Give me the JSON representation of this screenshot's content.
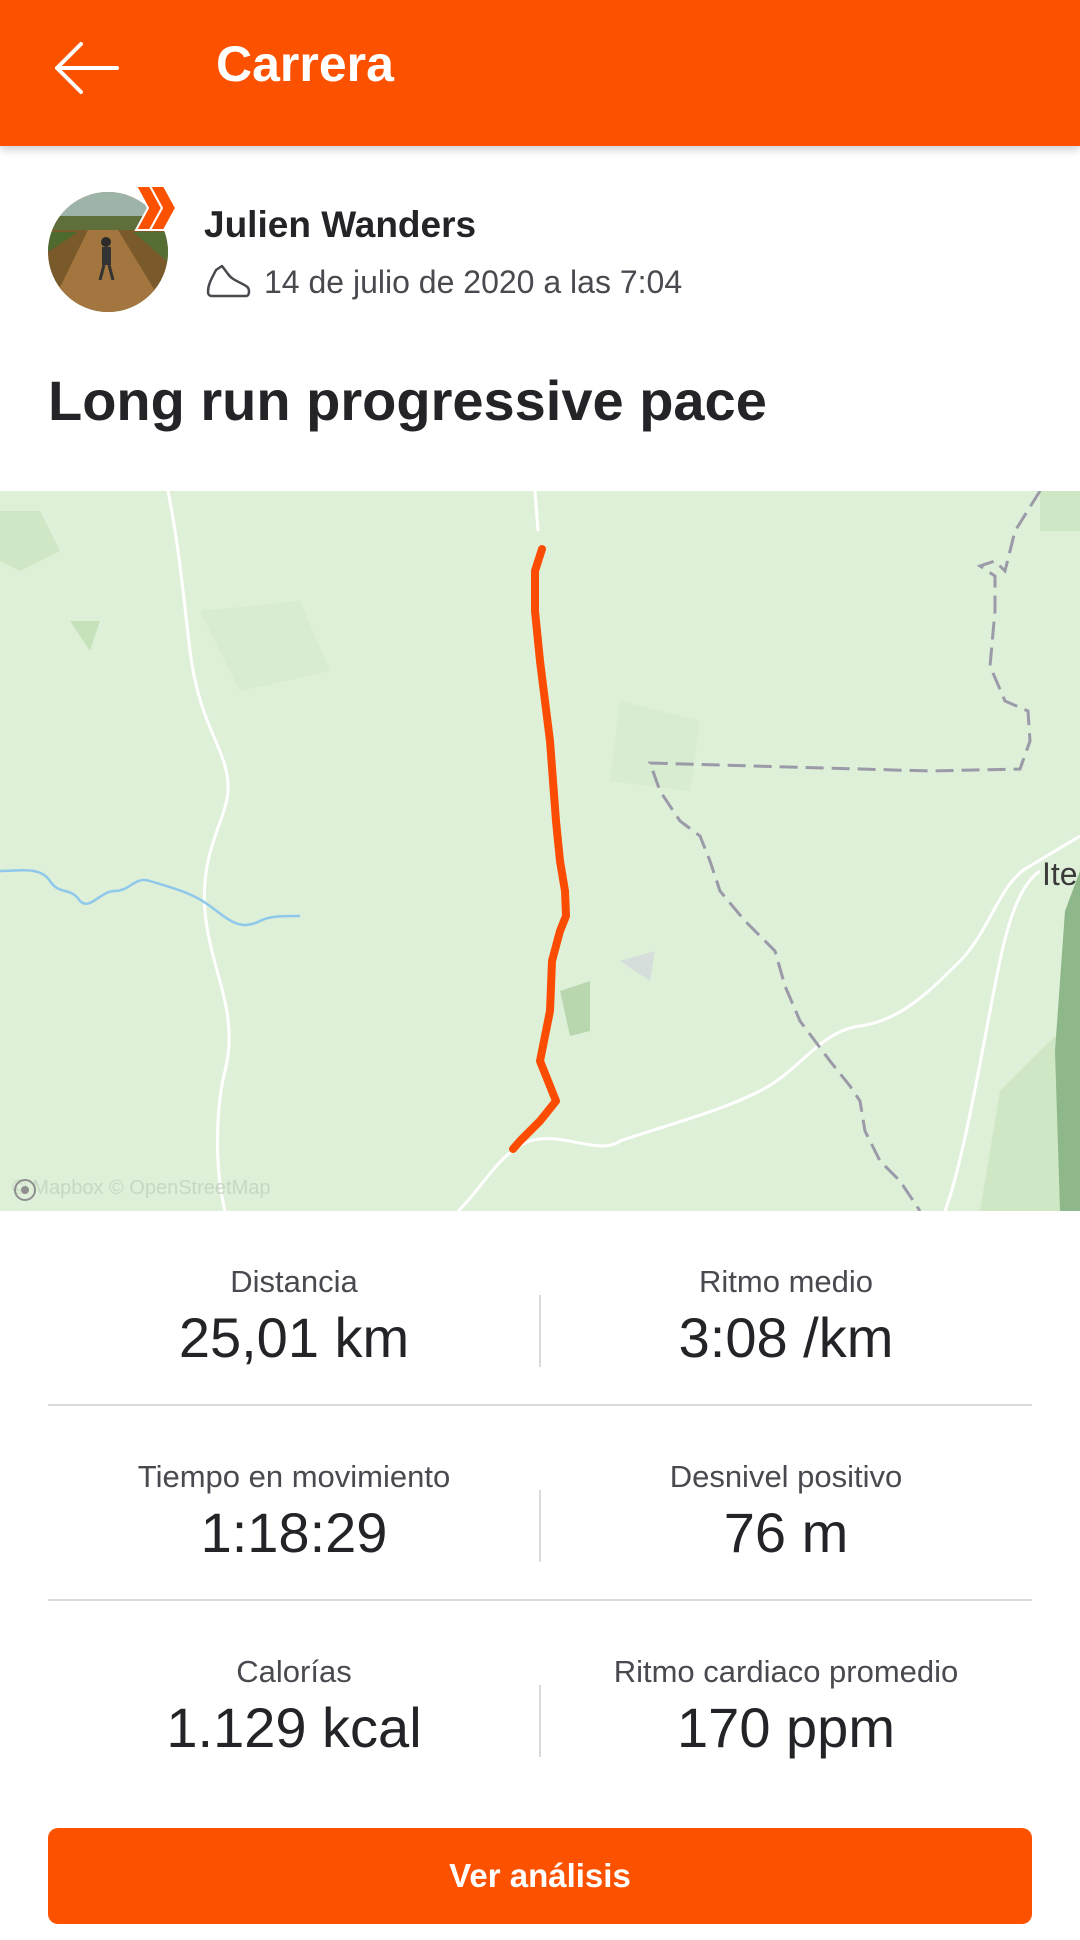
{
  "appbar": {
    "title": "Carrera",
    "back_icon": "arrow-left-icon",
    "background": "#fc5200"
  },
  "athlete": {
    "name": "Julien Wanders",
    "badge_icon": "subscriber-chevron-icon",
    "activity_icon": "shoe-icon",
    "datetime": "14 de julio de 2020 a las 7:04"
  },
  "activity": {
    "title": "Long run progressive pace"
  },
  "map": {
    "credits": "© Mapbox © OpenStreetMap",
    "place_label": "Ite",
    "route_color": "#fc4c02"
  },
  "stats": [
    {
      "left": {
        "label": "Distancia",
        "value": "25,01 km"
      },
      "right": {
        "label": "Ritmo medio",
        "value": "3:08 /km"
      }
    },
    {
      "left": {
        "label": "Tiempo en movimiento",
        "value": "1:18:29"
      },
      "right": {
        "label": "Desnivel positivo",
        "value": "76 m"
      }
    },
    {
      "left": {
        "label": "Calorías",
        "value": "1.129 kcal"
      },
      "right": {
        "label": "Ritmo cardiaco promedio",
        "value": "170 ppm"
      }
    }
  ],
  "cta": {
    "label": "Ver análisis"
  }
}
